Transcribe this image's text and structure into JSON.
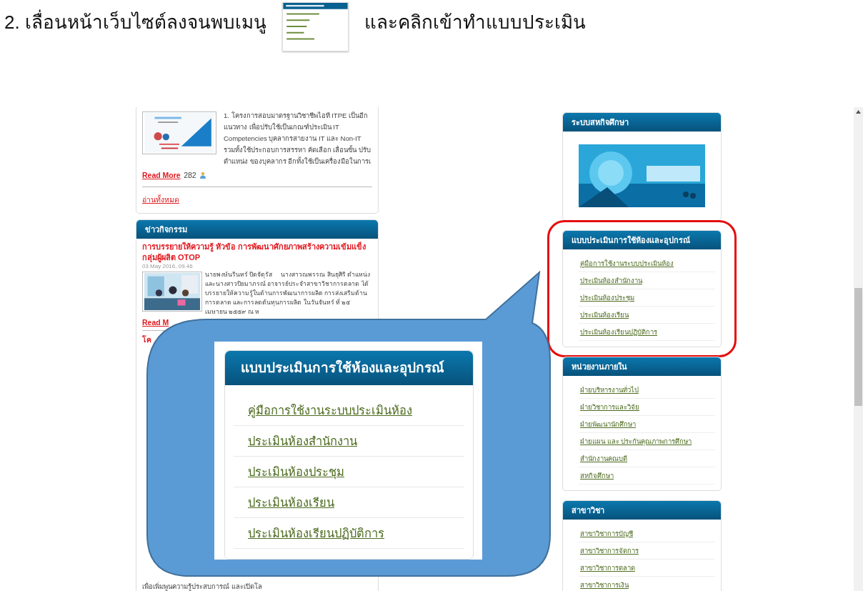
{
  "instruction": {
    "text_before": "2. เลื่อนหน้าเว็บไซต์ลงจนพบเมนู",
    "text_after": "และคลิกเข้าทำแบบประเมิน"
  },
  "news_card": {
    "body": "1. โครงการสอบมาตรฐานวิชาชีพไอที ITPE เป็นอีกแนวทาง เพื่อปรับใช้เป็นเกณฑ์ประเมิน IT Competencies บุคลากรสายงาน IT และ Non-IT รวมทั้งใช้ประกอบการสรรหา คัดเลือก เลื่อนขั้น ปรับตำแหน่ง ของบุคลากร อีกทั้งใช้เป็นเครื่องมือในการเ",
    "read_more": "Read More",
    "views": "282",
    "read_all": "อ่านทั้งหมด"
  },
  "activity_card": {
    "header": "ข่าวกิจกรรม",
    "title": "การบรรยายให้ความรู้ หัวข้อ การพัฒนาศักยภาพสร้างความเข้มแข็งกลุ่มผู้ผลิต OTOP",
    "date": "03 May 2016, 09.46",
    "body": "นายพงษ์นรินทร์ ปิดจัตุรัส     นางสาวณพรรณ สินธุศิริ ตำแหน่ง และนางสาวปิยมาภรณ์ อาจารย์ประจำสาขาวิชาการตลาด ได้บรรยายให้ความรู้ในด้านการพัฒนาการผลิต การส่งเสริมด้านการตลาด และการลดต้นทุนการผลิต ในวันจันทร์ ที่ ๒๕ เมษายน ๒๕๕๙ ณ ห",
    "read_more": "Read M",
    "next_title": "โค",
    "bottom_text": "เพื่อเพิ่มพูนความรู้ประสบการณ์ และเปิดโล"
  },
  "sidebar": [
    {
      "kind": "banner",
      "title": "ระบบสหกิจศึกษา",
      "highlighted": false
    },
    {
      "kind": "links",
      "title": "แบบประเมินการใช้ห้องและอุปกรณ์",
      "highlighted": true,
      "items": [
        "คู่มือการใช้งานระบบประเมินห้อง",
        "ประเมินห้องสำนักงาน",
        "ประเมินห้องประชุม",
        "ประเมินห้องเรียน",
        "ประเมินห้องเรียนปฏิบัติการ"
      ]
    },
    {
      "kind": "links",
      "title": "หน่วยงานภายใน",
      "highlighted": false,
      "items": [
        "ฝ่ายบริหารงานทั่วไป",
        "ฝ่ายวิชาการและวิจัย",
        "ฝ่ายพัฒนานักศึกษา",
        "ฝ่ายแผน และ ประกันคุณภาพการศึกษา",
        "สำนักงานคณบดี",
        "สหกิจศึกษา"
      ]
    },
    {
      "kind": "links",
      "title": "สาขาวิชา",
      "highlighted": false,
      "items": [
        "สาขาวิชาการบัญชี",
        "สาขาวิชาการจัดการ",
        "สาขาวิชาการตลาด",
        "สาขาวิชาการเงิน"
      ]
    }
  ],
  "callout": {
    "title": "แบบประเมินการใช้ห้องและอุปกรณ์",
    "items": [
      "คู่มือการใช้งานระบบประเมินห้อง",
      "ประเมินห้องสำนักงาน",
      "ประเมินห้องประชุม",
      "ประเมินห้องเรียน",
      "ประเมินห้องเรียนปฏิบัติการ"
    ]
  }
}
